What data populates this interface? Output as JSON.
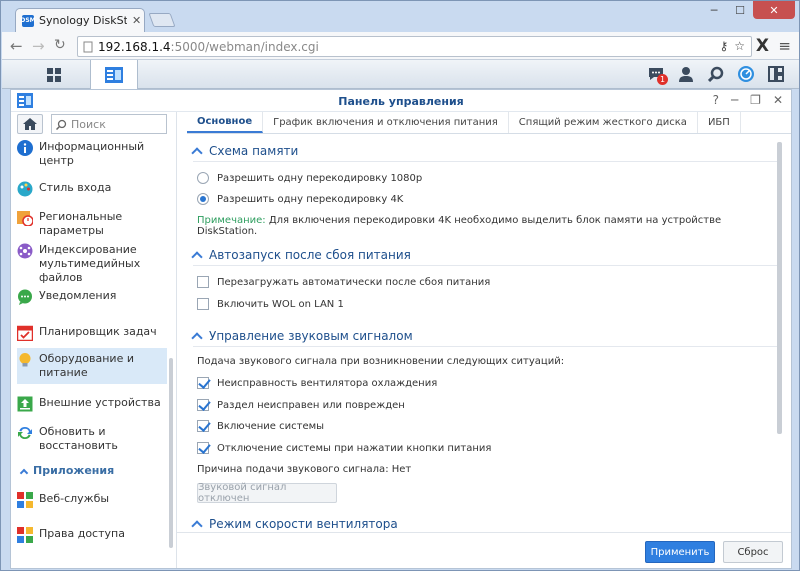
{
  "browser": {
    "tab_title": "Synology DiskStation - DS",
    "tab_favicon_text": "DSM",
    "url_host": "192.168.1.4",
    "url_path": ":5000/webman/index.cgi"
  },
  "dsm": {
    "notification_count": "1"
  },
  "control_panel": {
    "title": "Панель управления"
  },
  "sidebar": {
    "search_placeholder": "Поиск",
    "items": [
      {
        "label": "Информационный центр"
      },
      {
        "label": "Стиль входа"
      },
      {
        "label": "Региональные параметры"
      },
      {
        "label": "Индексирование мультимедийных файлов"
      },
      {
        "label": "Уведомления"
      },
      {
        "label": "Планировщик задач"
      },
      {
        "label": "Оборудование и питание"
      },
      {
        "label": "Внешние устройства"
      },
      {
        "label": "Обновить и восстановить"
      },
      {
        "label": "Веб-службы"
      },
      {
        "label": "Права доступа"
      }
    ],
    "section_apps": "Приложения"
  },
  "tabs": [
    {
      "label": "Основное"
    },
    {
      "label": "График включения и отключения питания"
    },
    {
      "label": "Спящий режим жесткого диска"
    },
    {
      "label": "ИБП"
    }
  ],
  "memory": {
    "heading": "Схема памяти",
    "option1": "Разрешить одну перекодировку 1080p",
    "option2": "Разрешить одну перекодировку 4K",
    "note_label": "Примечание:",
    "note_text": " Для включения перекодировки 4K необходимо выделить блок памяти на устройстве DiskStation."
  },
  "autostart": {
    "heading": "Автозапуск после сбоя питания",
    "opt1": "Перезагружать автоматически после сбоя питания",
    "opt2": "Включить WOL on LAN 1"
  },
  "beep": {
    "heading": "Управление звуковым сигналом",
    "intro": "Подача звукового сигнала при возникновении следующих ситуаций:",
    "opt1": "Неисправность вентилятора охлаждения",
    "opt2": "Раздел неисправен или поврежден",
    "opt3": "Включение системы",
    "opt4": "Отключение системы при нажатии кнопки питания",
    "reason": "Причина подачи звукового сигнала: Нет",
    "mute_button": "Звуковой сигнал отключен"
  },
  "fan": {
    "heading": "Режим скорости вентилятора"
  },
  "footer": {
    "apply": "Применить",
    "reset": "Сброс"
  }
}
